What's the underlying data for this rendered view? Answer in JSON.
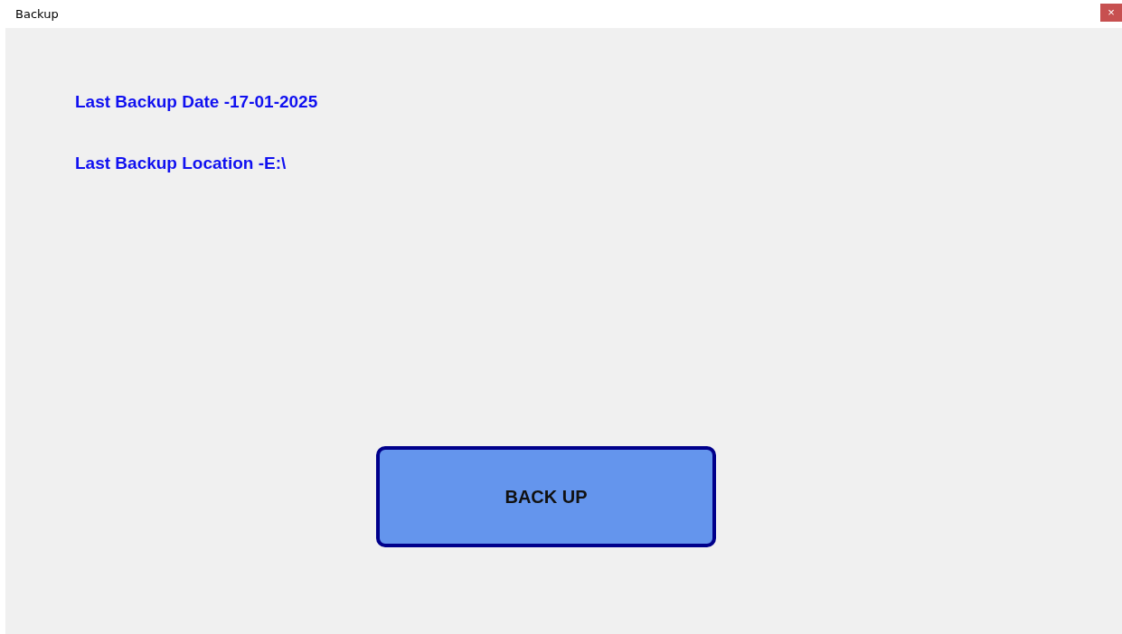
{
  "window": {
    "title": "Backup",
    "close_glyph": "×"
  },
  "info": [
    "Last Backup Date -17-01-2025",
    "Last Backup Location -E:\\"
  ],
  "button": {
    "label": "BACK UP"
  }
}
